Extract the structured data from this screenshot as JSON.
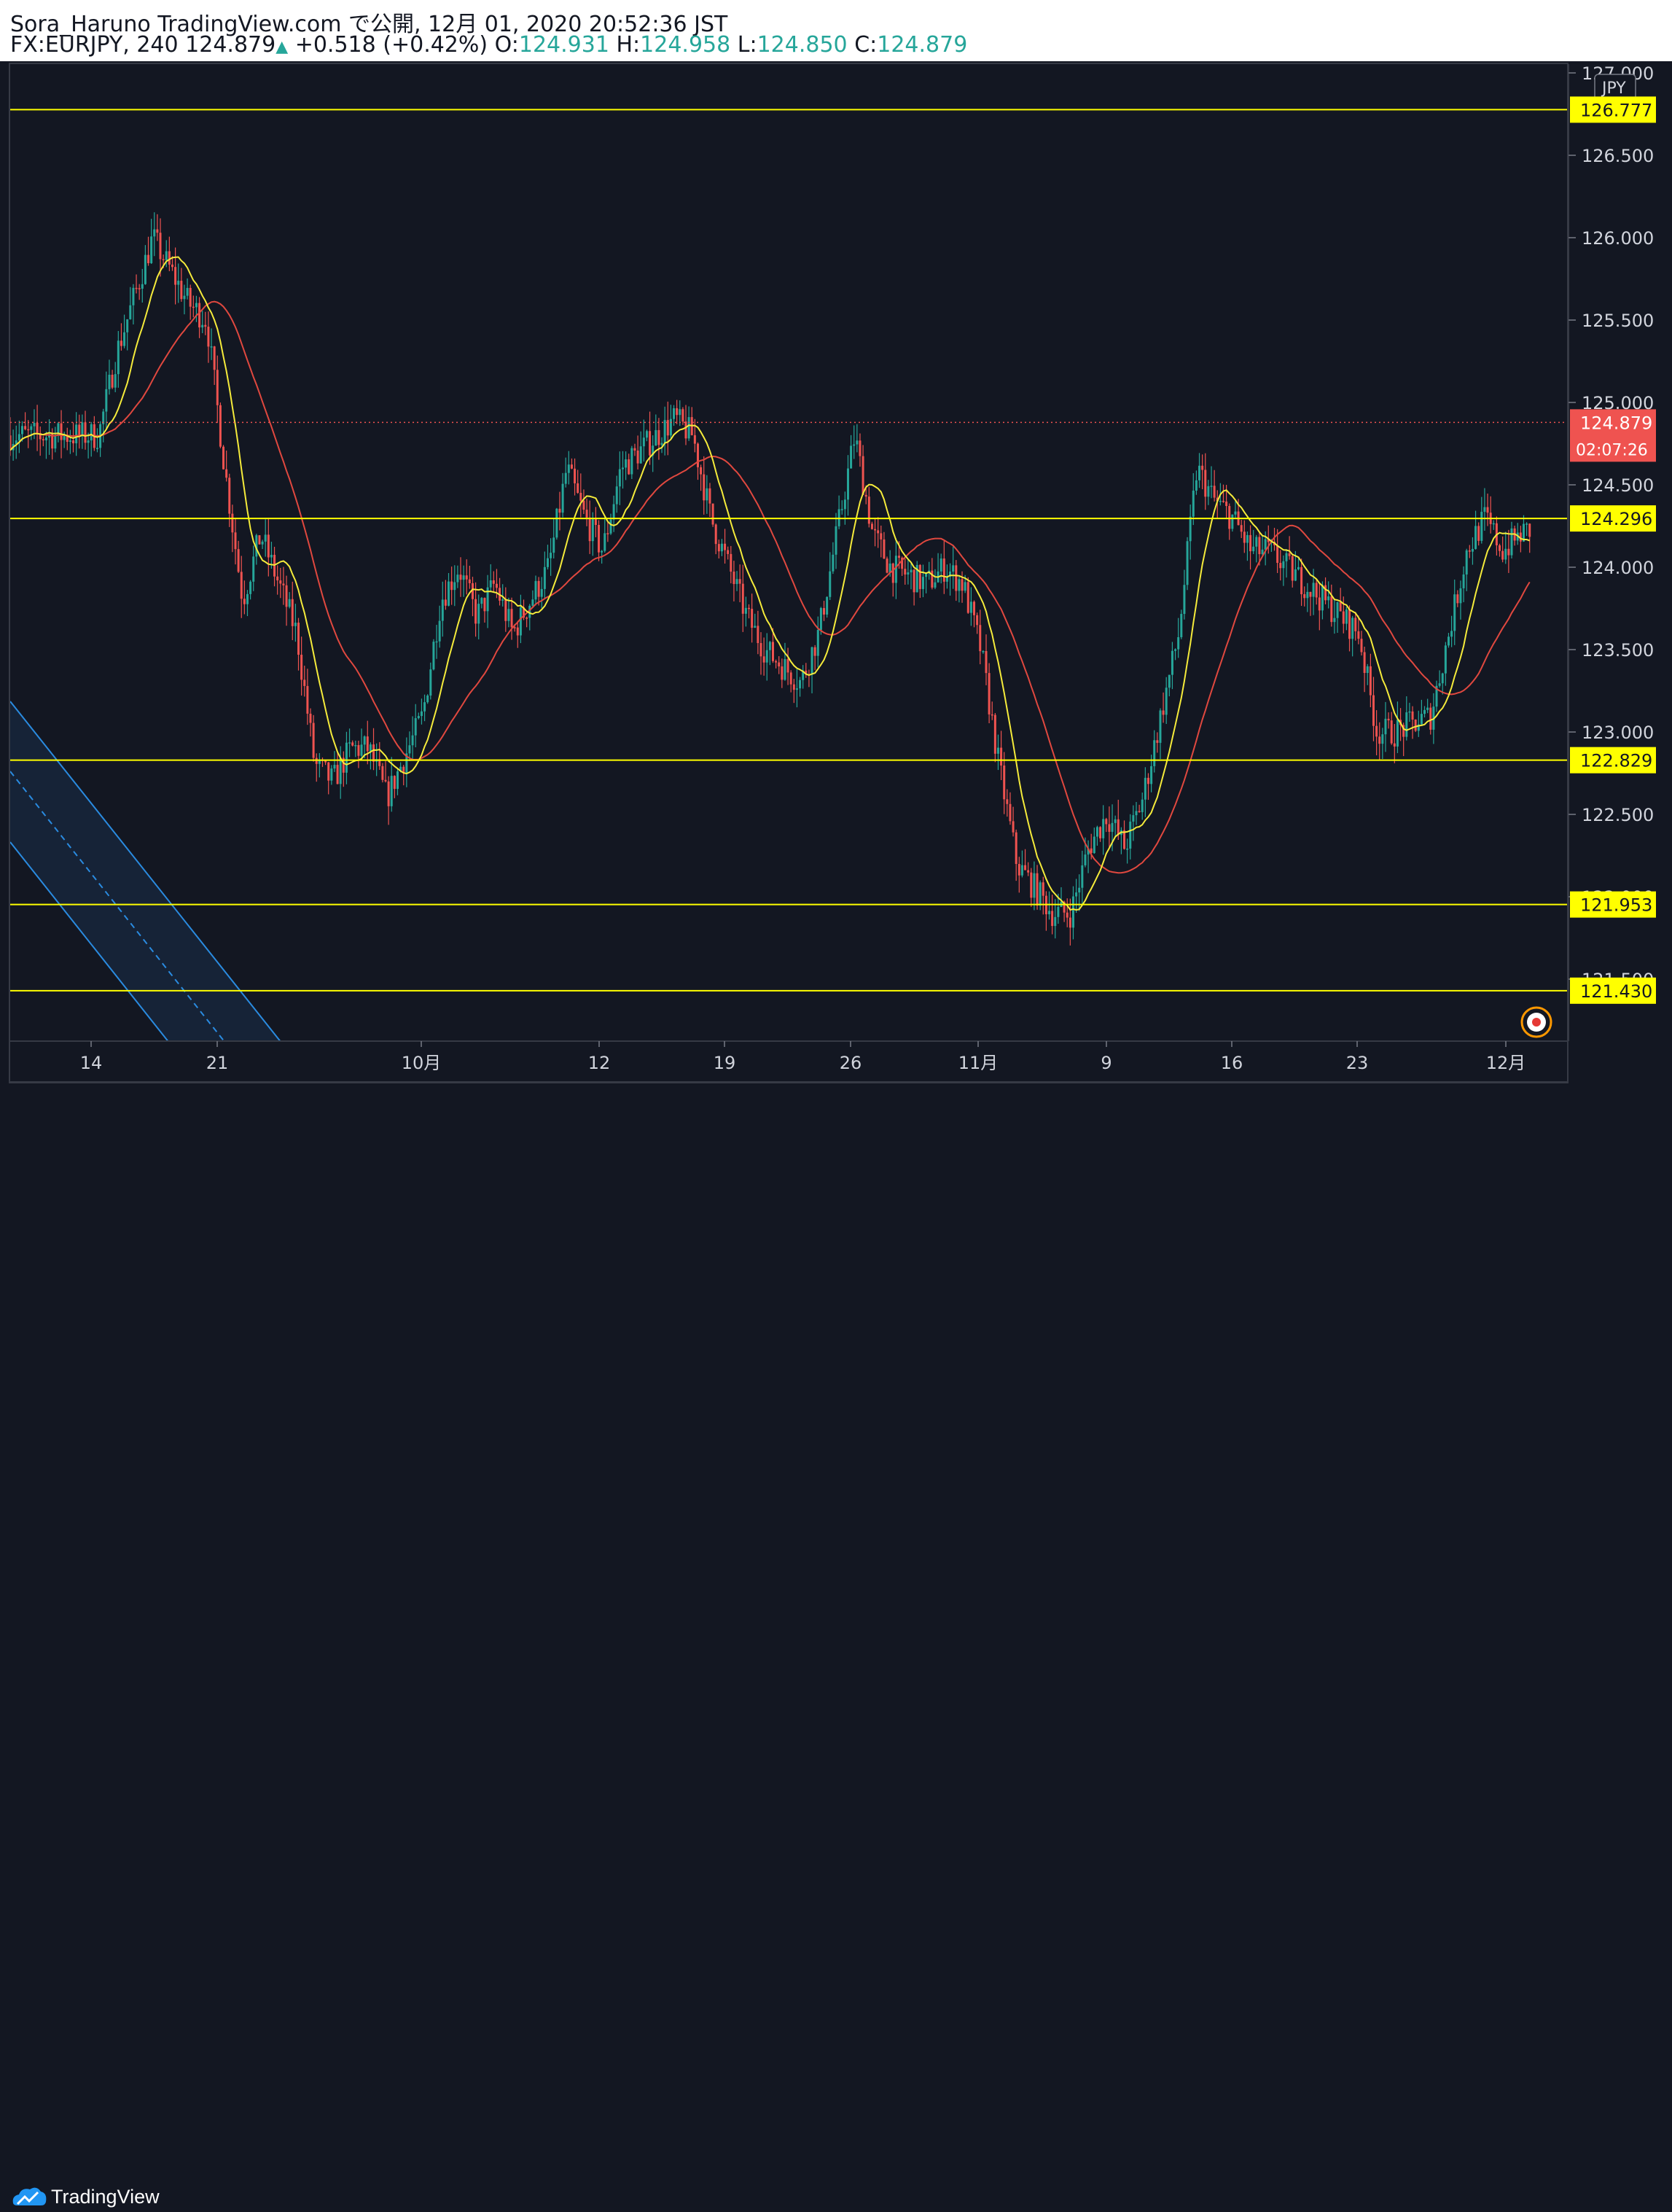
{
  "header": {
    "publisher": "Sora_Haruno TradingView.com で公開, 12月 01, 2020 20:52:36 JST",
    "symbol": "FX:EURJPY, 240",
    "last": "124.879",
    "change": "+0.518 (+0.42%)",
    "o_label": "O:",
    "o_value": "124.931",
    "h_label": "H:",
    "h_value": "124.958",
    "l_label": "L:",
    "l_value": "124.850",
    "c_label": "C:",
    "c_value": "124.879"
  },
  "footer": {
    "brand": "TradingView"
  },
  "colors": {
    "background": "#131722",
    "up": "#26a69a",
    "down": "#ef5350",
    "ma_fast": "#f5eb3b",
    "ma_slow": "#e0483f",
    "hline": "#ffff00",
    "channel": "#2a8be0"
  },
  "chart_data": {
    "type": "candlestick",
    "title": "FX:EURJPY, 240",
    "currency_label": "JPY",
    "ylim": [
      121.2,
      127.1
    ],
    "y_ticks": [
      "127.000",
      "126.500",
      "126.000",
      "125.500",
      "125.000",
      "124.500",
      "124.000",
      "123.500",
      "123.000",
      "122.500",
      "122.000",
      "121.500"
    ],
    "x_ticks": [
      "14",
      "21",
      "10月",
      "12",
      "19",
      "26",
      "11月",
      "9",
      "16",
      "23",
      "12月"
    ],
    "horizontal_levels": [
      {
        "price": 126.777,
        "label": "126.777"
      },
      {
        "price": 124.296,
        "label": "124.296"
      },
      {
        "price": 122.829,
        "label": "122.829"
      },
      {
        "price": 121.953,
        "label": "121.953"
      },
      {
        "price": 121.43,
        "label": "121.430"
      }
    ],
    "last_price": {
      "price": 124.879,
      "label": "124.879",
      "countdown": "02:07:26"
    },
    "price_path": [
      [
        "09-10",
        124.8
      ],
      [
        "09-11",
        125.3
      ],
      [
        "09-13",
        126.0
      ],
      [
        "09-14",
        125.8
      ],
      [
        "09-15",
        125.6
      ],
      [
        "09-16",
        125.5
      ],
      [
        "09-17",
        124.6
      ],
      [
        "09-18",
        123.8
      ],
      [
        "09-19",
        124.2
      ],
      [
        "09-21",
        123.6
      ],
      [
        "09-22",
        122.8
      ],
      [
        "09-23",
        122.7
      ],
      [
        "09-24",
        122.9
      ],
      [
        "09-25",
        122.9
      ],
      [
        "09-26",
        122.6
      ],
      [
        "09-28",
        123.1
      ],
      [
        "09-29",
        123.8
      ],
      [
        "09-30",
        124.0
      ],
      [
        "10-01",
        123.7
      ],
      [
        "10-02",
        123.9
      ],
      [
        "10-03",
        123.6
      ],
      [
        "10-05",
        124.0
      ],
      [
        "10-06",
        124.6
      ],
      [
        "10-07",
        124.3
      ],
      [
        "10-08",
        124.1
      ],
      [
        "10-09",
        124.6
      ],
      [
        "10-10",
        124.7
      ],
      [
        "10-12",
        124.9
      ],
      [
        "10-13",
        124.8
      ],
      [
        "10-14",
        124.3
      ],
      [
        "10-15",
        124.0
      ],
      [
        "10-16",
        123.7
      ],
      [
        "10-17",
        123.5
      ],
      [
        "10-19",
        123.3
      ],
      [
        "10-20",
        123.6
      ],
      [
        "10-21",
        124.2
      ],
      [
        "10-22",
        124.8
      ],
      [
        "10-23",
        124.2
      ],
      [
        "10-24",
        124.0
      ],
      [
        "10-26",
        123.9
      ],
      [
        "10-27",
        124.0
      ],
      [
        "10-28",
        123.9
      ],
      [
        "10-29",
        123.5
      ],
      [
        "10-30",
        122.8
      ],
      [
        "10-31",
        122.2
      ],
      [
        "11-02",
        121.9
      ],
      [
        "11-03",
        121.9
      ],
      [
        "11-04",
        122.3
      ],
      [
        "11-05",
        122.5
      ],
      [
        "11-06",
        122.3
      ],
      [
        "11-07",
        122.6
      ],
      [
        "11-09",
        123.6
      ],
      [
        "11-10",
        124.6
      ],
      [
        "11-11",
        124.4
      ],
      [
        "11-12",
        124.3
      ],
      [
        "11-13",
        124.1
      ],
      [
        "11-14",
        124.1
      ],
      [
        "11-16",
        123.9
      ],
      [
        "11-17",
        123.8
      ],
      [
        "11-18",
        123.7
      ],
      [
        "11-19",
        123.6
      ],
      [
        "11-20",
        123.0
      ],
      [
        "11-21",
        123.0
      ],
      [
        "11-23",
        123.1
      ],
      [
        "11-24",
        123.6
      ],
      [
        "11-25",
        124.1
      ],
      [
        "11-26",
        124.3
      ],
      [
        "11-27",
        124.1
      ],
      [
        "11-28",
        124.2
      ],
      [
        "11-30",
        124.3
      ],
      [
        "12-01",
        124.879
      ]
    ],
    "series": [
      {
        "name": "",
        "style": "line",
        "color": "#f5eb3b"
      },
      {
        "name": "",
        "style": "line",
        "color": "#e0483f"
      }
    ],
    "grid": false
  }
}
